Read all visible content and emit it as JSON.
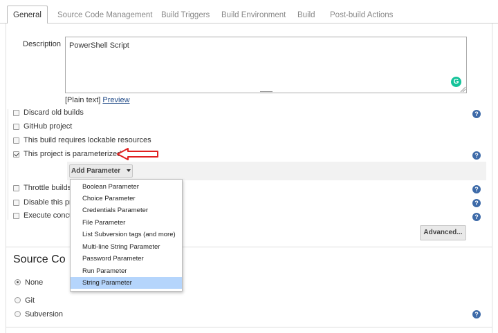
{
  "tabs": [
    "General",
    "Source Code Management",
    "Build Triggers",
    "Build Environment",
    "Build",
    "Post-build Actions"
  ],
  "description": {
    "label": "Description",
    "value": "PowerShell Script",
    "format_note": "[Plain text]",
    "preview_link": "Preview"
  },
  "options": [
    {
      "label": "Discard old builds",
      "checked": false
    },
    {
      "label": "GitHub project",
      "checked": false
    },
    {
      "label": "This build requires lockable resources",
      "checked": false
    },
    {
      "label": "This project is parameterized",
      "checked": true
    },
    {
      "label": "Throttle builds",
      "checked": false
    },
    {
      "label": "Disable this pr",
      "checked": false
    },
    {
      "label": "Execute concu",
      "checked": false
    }
  ],
  "add_parameter": {
    "label": "Add Parameter",
    "menu": [
      "Boolean Parameter",
      "Choice Parameter",
      "Credentials Parameter",
      "File Parameter",
      "List Subversion tags (and more)",
      "Multi-line String Parameter",
      "Password Parameter",
      "Run Parameter",
      "String Parameter"
    ],
    "highlighted": "String Parameter"
  },
  "advanced_button": "Advanced...",
  "scm": {
    "title": "Source Co",
    "options": [
      {
        "label": "None",
        "selected": true
      },
      {
        "label": "Git",
        "selected": false
      },
      {
        "label": "Subversion",
        "selected": false
      }
    ]
  },
  "help_glyph": "?",
  "grammarly_glyph": "G",
  "colors": {
    "annotation_arrow": "#e02020",
    "highlight": "#b5d5fc",
    "help": "#3d6aa8"
  }
}
